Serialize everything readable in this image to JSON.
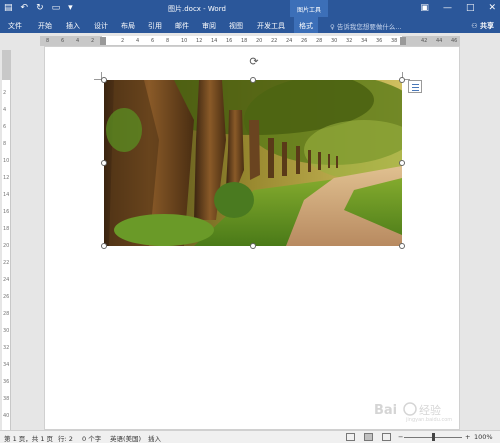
{
  "window": {
    "title": "图片.docx - Word",
    "context_tab": "图片工具",
    "quick_access": {
      "autosave_icon": "word-icon",
      "undo_icon": "undo-icon",
      "redo_icon": "redo-icon",
      "save_icon": "save-icon",
      "customize_icon": "chevron-down-icon"
    },
    "controls": {
      "ribbon_options": "▣",
      "minimize": "—",
      "maximize": "□",
      "close": "✕"
    }
  },
  "ribbon": {
    "tabs": [
      "文件",
      "开始",
      "插入",
      "设计",
      "布局",
      "引用",
      "邮件",
      "审阅",
      "视图",
      "开发工具",
      "格式"
    ],
    "active_tab": "格式",
    "tell_me": "告诉我您想要做什么...",
    "share": "共享"
  },
  "ruler": {
    "ticks": [
      "8",
      "6",
      "4",
      "2",
      "",
      "2",
      "4",
      "6",
      "8",
      "10",
      "12",
      "14",
      "16",
      "18",
      "20",
      "22",
      "24",
      "26",
      "28",
      "30",
      "32",
      "34",
      "36",
      "38",
      "",
      "42",
      "44",
      "46"
    ],
    "vertical_ticks": [
      "2",
      "4",
      "6",
      "8",
      "10",
      "12",
      "14",
      "16",
      "18",
      "20",
      "22",
      "24",
      "26",
      "28",
      "30",
      "32",
      "34",
      "36",
      "38",
      "40"
    ]
  },
  "document": {
    "image_description_icon": "landscape-photo",
    "layout_options_icon": "layout-options-icon",
    "rotate_icon": "rotate-handle-icon"
  },
  "status": {
    "page": "第 1 页，共 1 页",
    "line": "行: 2",
    "words": "0 个字",
    "language": "英语(美国)",
    "mode": "插入",
    "zoom": "100%",
    "zoom_level": 1.0,
    "minus": "−",
    "plus": "+"
  },
  "watermark": {
    "text": "Bai 经验",
    "sub": "jingyan.baidu.com"
  },
  "colors": {
    "accent": "#2b579a",
    "context": "#3c6fb8"
  }
}
